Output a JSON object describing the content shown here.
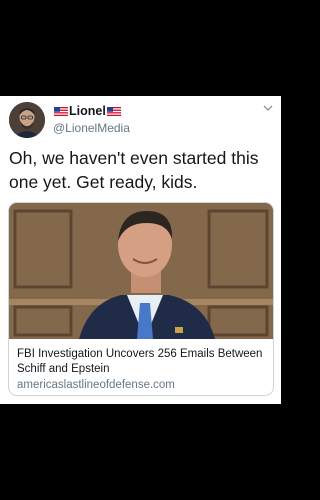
{
  "tweet": {
    "display_name": "Lionel",
    "flag_icon": "us-flag-icon",
    "handle": "@LionelMedia",
    "text": "Oh, we haven't even started this one yet. Get ready, kids.",
    "menu_icon": "chevron-down-icon"
  },
  "card": {
    "title": "FBI Investigation Uncovers 256 Emails Between Schiff and Epstein",
    "domain": "americaslastlineofdefense.com"
  },
  "colors": {
    "text": "#14171a",
    "secondary": "#657786",
    "border": "#ccd6dd"
  }
}
